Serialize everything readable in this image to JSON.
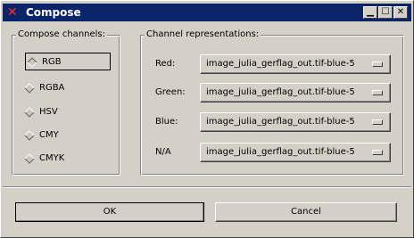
{
  "window": {
    "title": "Compose",
    "icon": "x-close-icon",
    "controls": [
      "minimize",
      "maximize",
      "close"
    ]
  },
  "channels": {
    "label": "Compose channels:",
    "options": [
      "RGB",
      "RGBA",
      "HSV",
      "CMY",
      "CMYK"
    ],
    "selected": "RGB"
  },
  "representations": {
    "label": "Channel representations:",
    "rows": [
      {
        "label": "Red:",
        "value": "image_julia_gerflag_out.tif-blue-5"
      },
      {
        "label": "Green:",
        "value": "image_julia_gerflag_out.tif-blue-5"
      },
      {
        "label": "Blue:",
        "value": "image_julia_gerflag_out.tif-blue-5"
      },
      {
        "label": "N/A",
        "value": "image_julia_gerflag_out.tif-blue-5"
      }
    ]
  },
  "buttons": {
    "ok": "OK",
    "cancel": "Cancel"
  },
  "colors": {
    "titlebar": "#0a246a",
    "face": "#d4d0c8",
    "title_icon": "#ff2a2a"
  }
}
